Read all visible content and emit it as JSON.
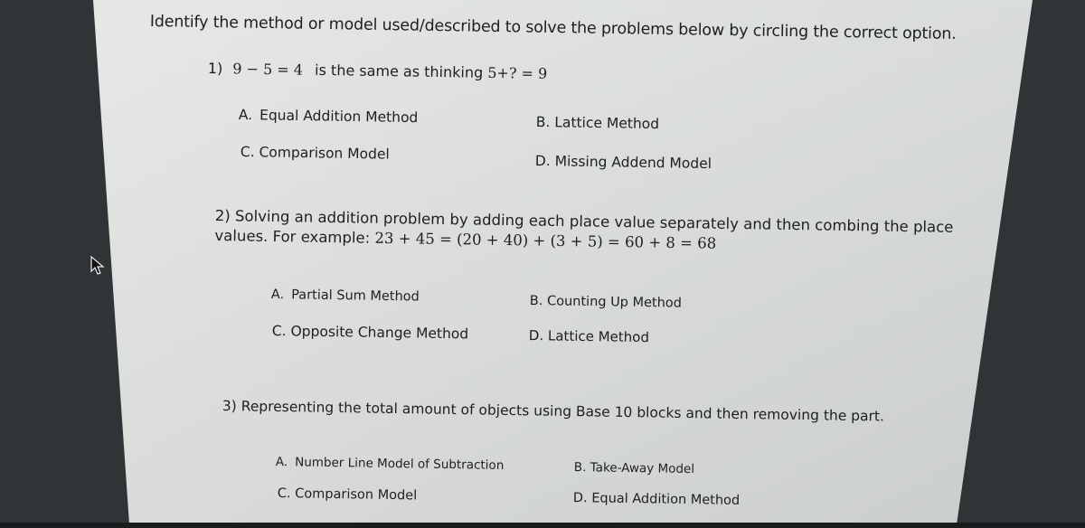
{
  "instructions": "Identify the method or model used/described to solve the problems below by circling the correct option.",
  "questions": [
    {
      "number": "1)",
      "equation": "9 − 5 = 4",
      "text": "is the same as thinking",
      "equation2": "5+? = 9",
      "options": [
        {
          "letter": "A.",
          "label": "Equal Addition Method"
        },
        {
          "letter": "B.",
          "label": "Lattice Method"
        },
        {
          "letter": "C.",
          "label": "Comparison Model"
        },
        {
          "letter": "D.",
          "label": "Missing Addend Model"
        }
      ]
    },
    {
      "number": "2)",
      "line1": "Solving an addition problem by adding each place value separately and then combing the place",
      "line2_prefix": "values. For example:",
      "line2_math": "23 + 45 = (20 + 40) + (3 + 5) = 60 + 8 = 68",
      "options": [
        {
          "letter": "A.",
          "label": "Partial Sum Method"
        },
        {
          "letter": "B.",
          "label": "Counting Up Method"
        },
        {
          "letter": "C.",
          "label": "Opposite Change Method"
        },
        {
          "letter": "D.",
          "label": "Lattice Method"
        }
      ]
    },
    {
      "number": "3)",
      "text": "Representing the total amount of objects using Base 10 blocks and then removing the part.",
      "options": [
        {
          "letter": "A.",
          "label": "Number Line Model of Subtraction"
        },
        {
          "letter": "B.",
          "label": "Take-Away Model"
        },
        {
          "letter": "C.",
          "label": "Comparison Model"
        },
        {
          "letter": "D.",
          "label": "Equal Addition Method"
        }
      ]
    }
  ]
}
